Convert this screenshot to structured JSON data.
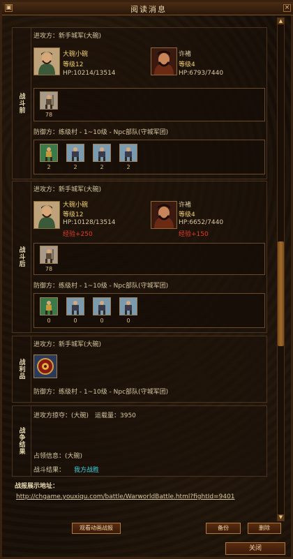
{
  "window": {
    "title": "阅读消息",
    "close_glyph": "×",
    "minimize_glyph": "▣"
  },
  "before": {
    "label": "战斗前",
    "attacker_line": "进攻方：新手城军(大碗)",
    "hero1": {
      "name": "大碗小碗",
      "level": "等级12",
      "hp": "HP:10214/13514"
    },
    "hero2": {
      "name": "许褚",
      "level": "等级4",
      "hp": "HP:6793/7440"
    },
    "attacker_units": [
      "78"
    ],
    "defender_line": "防御方：练级村 - 1~10级 - Npc部队(守城军团)",
    "defender_units": [
      "2",
      "2",
      "2",
      "2"
    ]
  },
  "after": {
    "label": "战斗后",
    "attacker_line": "进攻方：新手城军(大碗)",
    "hero1": {
      "name": "大碗小碗",
      "level": "等级12",
      "hp": "HP:10128/13514",
      "exp": "经验+250"
    },
    "hero2": {
      "name": "许褚",
      "level": "等级4",
      "hp": "HP:6652/7440",
      "exp": "经验+150"
    },
    "attacker_units": [
      "78"
    ],
    "defender_line": "防御方：练级村 - 1~10级 - Npc部队(守城军团)",
    "defender_units": [
      "0",
      "0",
      "0",
      "0"
    ]
  },
  "spoils": {
    "label": "战利品",
    "attacker_line": "进攻方：新手城军(大碗)",
    "defender_line": "防御方：练级村 - 1~10级 - Npc部队(守城军团)"
  },
  "result": {
    "label": "战争结果",
    "plunder": "进攻方掠夺：(大碗)",
    "load": "运载量：3950",
    "occupy": "占领信息：(大碗)",
    "outcome_label": "战斗结果：",
    "outcome_value": "我方战胜"
  },
  "report": {
    "heading": "战报展示地址：",
    "url": "http://chgame.youxiqu.com/battle/WarworldBattle.html?fightId=9401"
  },
  "buttons": {
    "watch": "观看动画战报",
    "backup": "备份",
    "delete": "删除",
    "close": "关闭"
  }
}
